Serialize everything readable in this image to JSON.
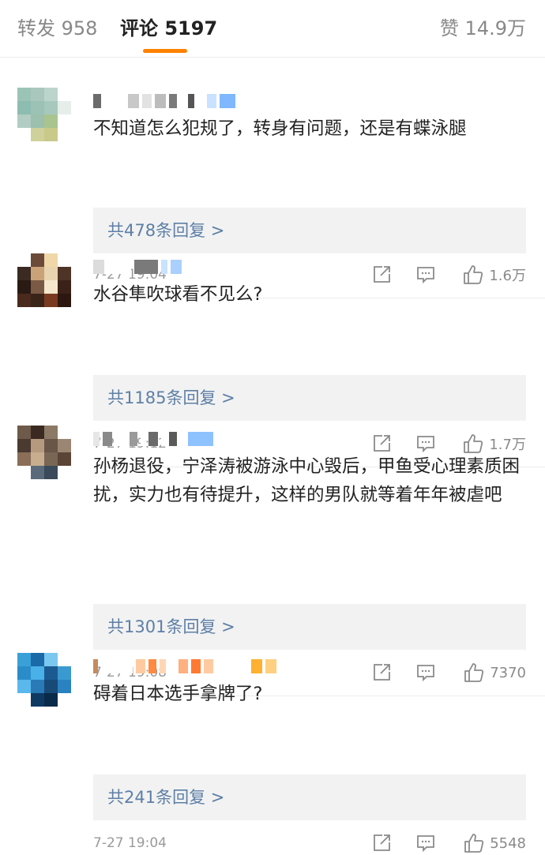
{
  "tabs": {
    "repost": "转发 958",
    "comments": "评论 5197",
    "likes": "赞 14.9万"
  },
  "colors": {
    "accent": "#ff8200",
    "link": "#5d7fa6"
  },
  "comments": [
    {
      "text": "不知道怎么犯规了，转身有问题，还是有蝶泳腿",
      "replies": "共478条回复 >",
      "time": "7-27 19:04",
      "likes": "1.6万"
    },
    {
      "text": "水谷隼吹球看不见么?",
      "replies": "共1185条回复 >",
      "time": "7-27 19:12",
      "likes": "1.7万"
    },
    {
      "text": "孙杨退役，宁泽涛被游泳中心毁后，甲鱼受心理素质困扰，实力也有待提升，这样的男队就等着年年被虐吧",
      "replies": "共1301条回复 >",
      "time": "7-27 19:08",
      "likes": "7370"
    },
    {
      "text": "碍着日本选手拿牌了?",
      "replies": "共241条回复 >",
      "time": "7-27 19:04",
      "likes": "5548"
    }
  ]
}
